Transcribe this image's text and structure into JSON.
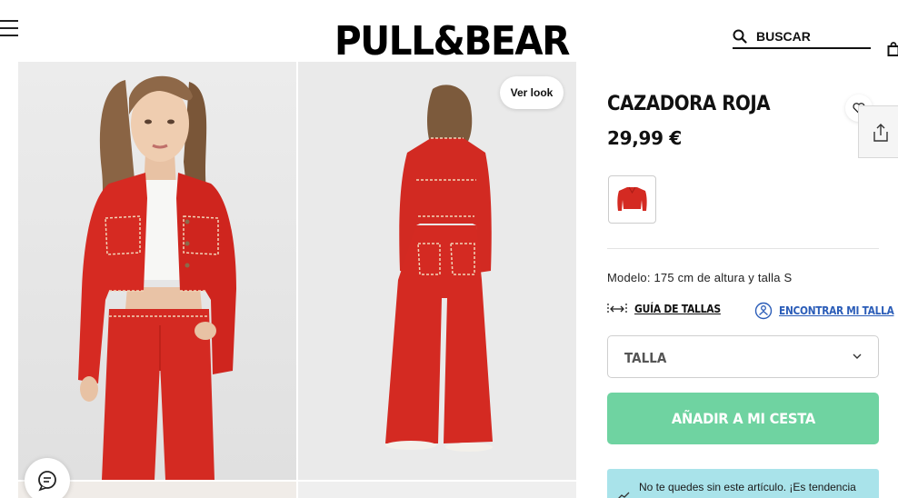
{
  "header": {
    "logo": "PULL&BEAR",
    "search_placeholder": "BUSCAR",
    "menu_icon": "hamburger-menu-icon",
    "bag_icon": "shopping-bag-icon"
  },
  "gallery": {
    "ver_look_label": "Ver look",
    "chat_icon": "chat-bubble-icon"
  },
  "product": {
    "title": "CAZADORA ROJA",
    "price": "29,99 €",
    "model_info": "Modelo: 175 cm de altura y talla S",
    "size_guide_label": "GUÍA DE TALLAS",
    "find_size_label": "ENCONTRAR MI TALLA",
    "size_select_label": "TALLA",
    "add_to_cart_label": "AÑADIR A MI CESTA",
    "promo_text": "No te quedes sin este artículo. ¡Es tendencia"
  },
  "colors": {
    "accent_green": "#6fd3a1",
    "link_blue": "#2b5db8",
    "promo_bg": "#a9e3ea",
    "garment_red": "#d42a22"
  }
}
